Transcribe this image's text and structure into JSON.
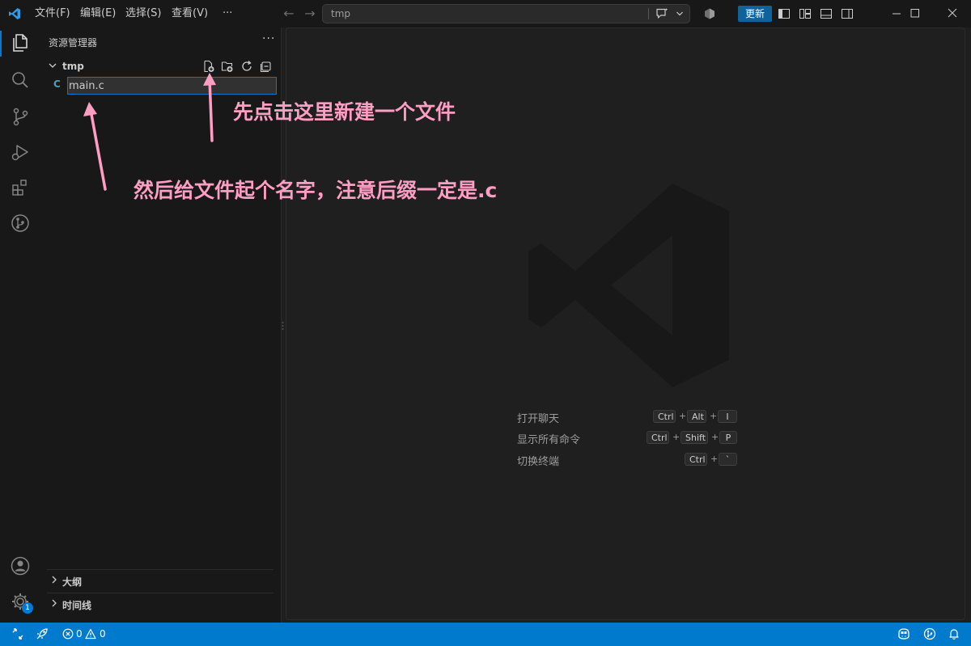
{
  "titlebar": {
    "menus": [
      "文件(F)",
      "编辑(E)",
      "选择(S)",
      "查看(V)",
      "···"
    ],
    "search_text": "tmp",
    "update_label": "更新"
  },
  "sidebar": {
    "title": "资源管理器",
    "more": "···",
    "folder_name": "tmp",
    "file_type_icon": "C",
    "file_name_value": "main.c",
    "sections": [
      "大纲",
      "时间线"
    ]
  },
  "editor": {
    "shortcuts": [
      {
        "label": "打开聊天",
        "keys": [
          "Ctrl",
          "Alt",
          "I"
        ]
      },
      {
        "label": "显示所有命令",
        "keys": [
          "Ctrl",
          "Shift",
          "P"
        ]
      },
      {
        "label": "切换终端",
        "keys": [
          "Ctrl",
          "`"
        ]
      }
    ],
    "plus": "+"
  },
  "annotations": {
    "top": "先点击这里新建一个文件",
    "bottom": "然后给文件起个名字，注意后缀一定是.c"
  },
  "statusbar": {
    "errors": "0",
    "warnings": "0"
  },
  "notification_badge": "1",
  "colors": {
    "accent": "#0078d4",
    "statusbar": "#007acc",
    "annotation": "#ff9ec2",
    "c_file": "#519aba"
  }
}
